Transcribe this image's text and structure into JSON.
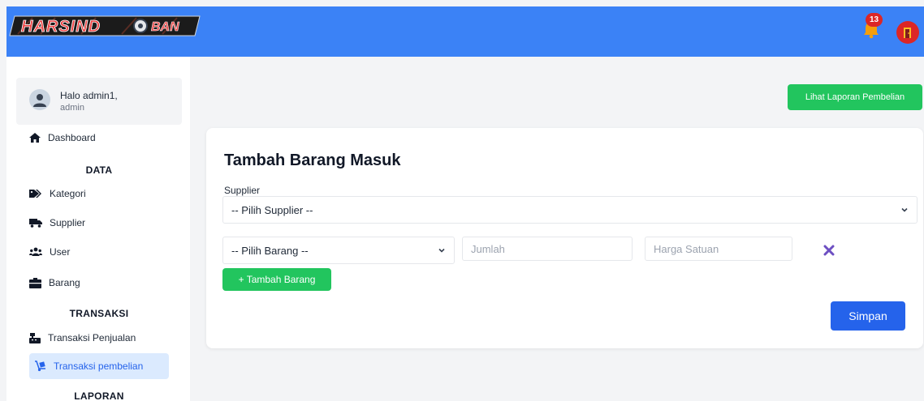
{
  "header": {
    "logo_text": "HARSINDO BAN",
    "notification_count": "13"
  },
  "user": {
    "greeting": "Halo admin1,",
    "role": "admin"
  },
  "sidebar": {
    "items": [
      {
        "label": "Dashboard",
        "icon": "home-icon"
      },
      {
        "label": "Kategori",
        "icon": "tags-icon"
      },
      {
        "label": "Supplier",
        "icon": "truck-icon"
      },
      {
        "label": "User",
        "icon": "users-icon"
      },
      {
        "label": "Barang",
        "icon": "box-icon"
      },
      {
        "label": "Transaksi Penjualan",
        "icon": "cash-register-icon"
      },
      {
        "label": "Transaksi pembelian",
        "icon": "dolly-icon",
        "active": true
      }
    ],
    "sections": {
      "data": "DATA",
      "transaksi": "TRANSAKSI",
      "laporan": "LAPORAN"
    }
  },
  "main": {
    "report_button": "Lihat Laporan Pembelian",
    "form_title": "Tambah Barang Masuk",
    "supplier_label": "Supplier",
    "supplier_select": "-- Pilih Supplier --",
    "item_row": {
      "barang_select": "-- Pilih Barang --",
      "jumlah_placeholder": "Jumlah",
      "harga_placeholder": "Harga Satuan"
    },
    "add_item_button": "+ Tambah Barang",
    "save_button": "Simpan"
  },
  "colors": {
    "topbar": "#3b82f6",
    "accent_green": "#22c55e",
    "primary_blue": "#2563eb",
    "danger_red": "#dc2626",
    "remove_purple": "#6d4fc2"
  }
}
